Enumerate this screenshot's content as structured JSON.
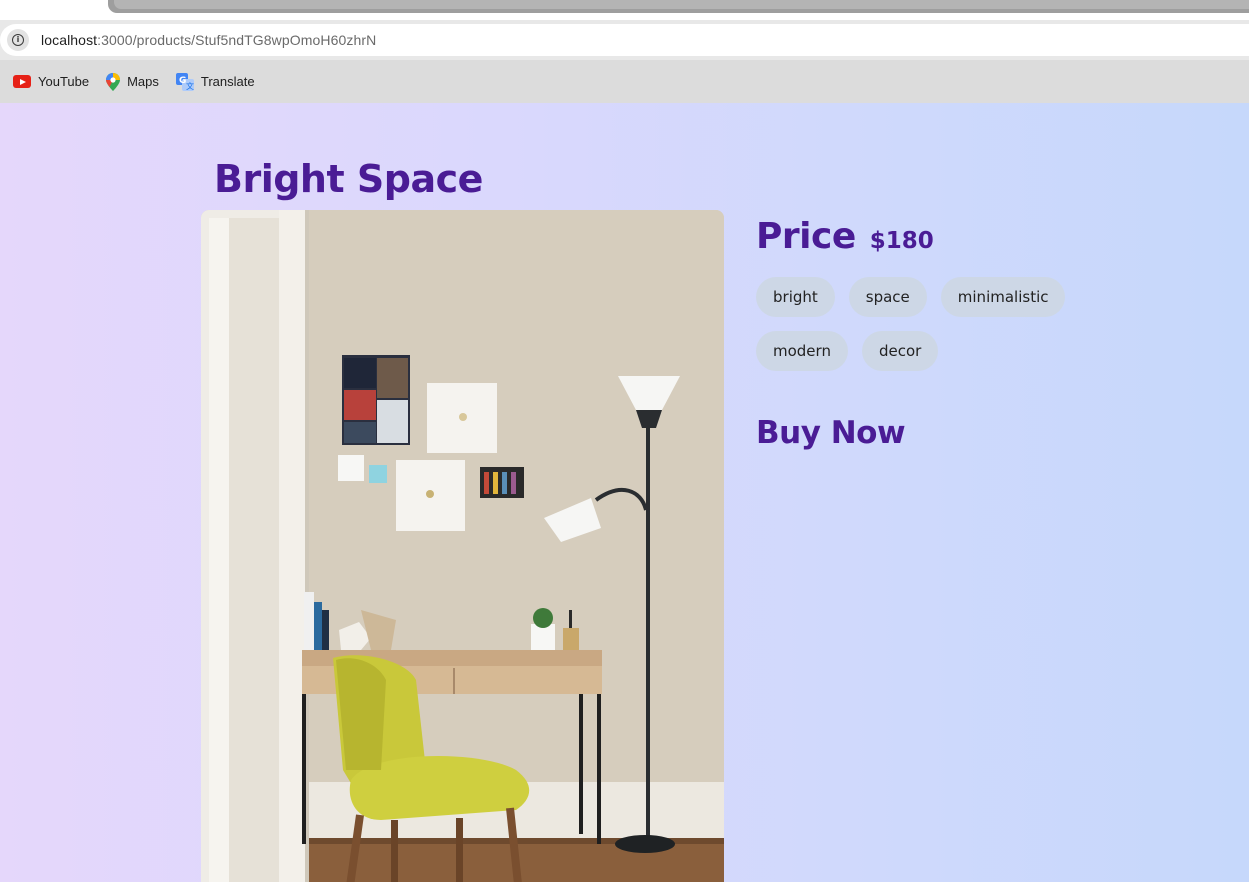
{
  "browser": {
    "url_host": "localhost",
    "url_path": ":3000/products/Stuf5ndTG8wpOmoH60zhrN",
    "bookmarks": [
      {
        "label": "YouTube",
        "icon": "youtube-icon"
      },
      {
        "label": "Maps",
        "icon": "maps-icon"
      },
      {
        "label": "Translate",
        "icon": "translate-icon"
      }
    ]
  },
  "product": {
    "title": "Bright Space",
    "image_alt": "Bright room with a yellow chair, wooden desk and floor lamp",
    "price_label": "Price",
    "price_value": "$180",
    "tags": [
      "bright",
      "space",
      "minimalistic",
      "modern",
      "decor"
    ],
    "buy_label": "Buy Now"
  },
  "colors": {
    "accent": "#4a1c95",
    "tag_bg": "#cdd7e6",
    "bg_left": "#e5d7fb",
    "bg_right": "#c6d8fb"
  }
}
